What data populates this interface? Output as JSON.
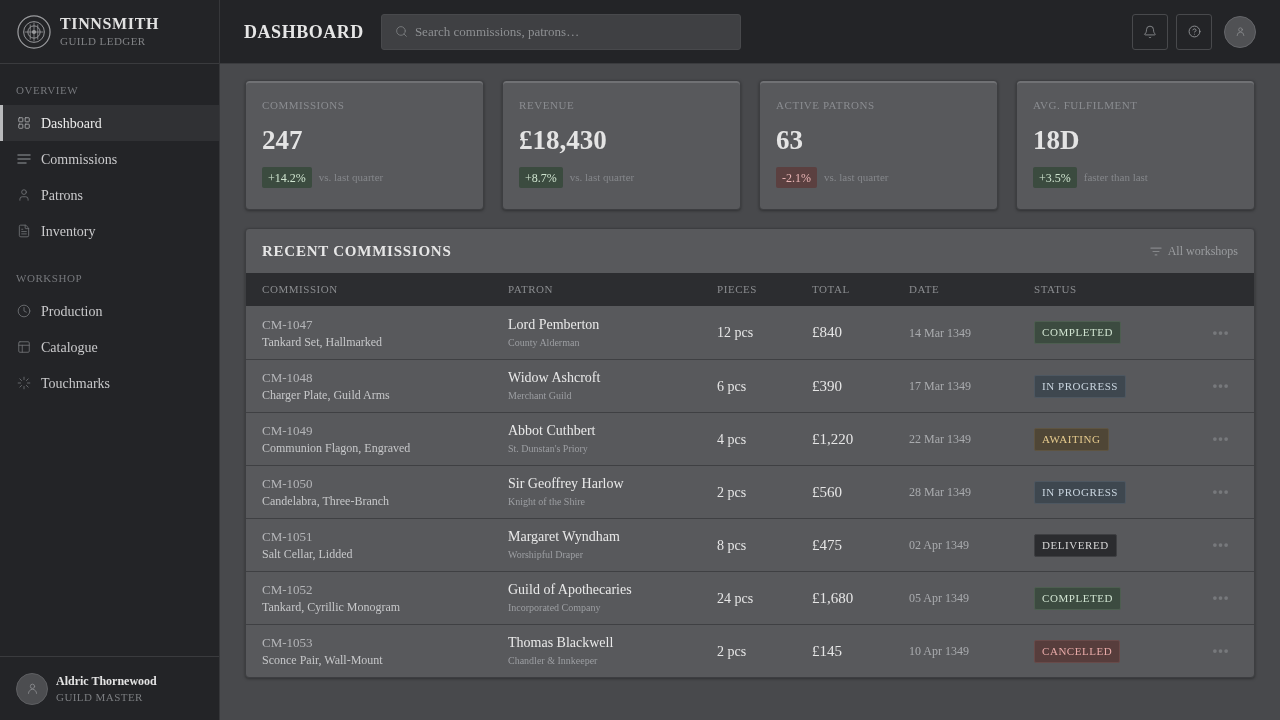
{
  "sidebar": {
    "brand": {
      "title": "TINNSMITH",
      "subtitle": "GUILD LEDGER"
    },
    "sections": [
      {
        "heading": "OVERVIEW",
        "items": [
          {
            "label": "Dashboard",
            "selected": true
          },
          {
            "label": "Commissions",
            "selected": false
          },
          {
            "label": "Patrons",
            "selected": false
          },
          {
            "label": "Inventory",
            "selected": false
          }
        ]
      },
      {
        "heading": "WORKSHOP",
        "items": [
          {
            "label": "Production",
            "selected": false
          },
          {
            "label": "Catalogue",
            "selected": false
          },
          {
            "label": "Touchmarks",
            "selected": false
          }
        ]
      }
    ],
    "user": {
      "name": "Aldric Thornewood",
      "role": "GUILD MASTER"
    }
  },
  "header": {
    "title": "DASHBOARD",
    "search": {
      "placeholder": "Search commissions, patrons…"
    }
  },
  "stats": [
    {
      "label": "COMMISSIONS",
      "value": "247",
      "delta": "+14.2%",
      "kind": "up",
      "note": "vs. last quarter"
    },
    {
      "label": "REVENUE",
      "value": "£18,430",
      "delta": "+8.7%",
      "kind": "up",
      "note": "vs. last quarter"
    },
    {
      "label": "ACTIVE PATRONS",
      "value": "63",
      "delta": "-2.1%",
      "kind": "down",
      "note": "vs. last quarter"
    },
    {
      "label": "AVG. FULFILMENT",
      "value": "18D",
      "delta": "+3.5%",
      "kind": "up",
      "note": "faster than last"
    }
  ],
  "table": {
    "title": "RECENT COMMISSIONS",
    "filter": "All workshops",
    "columns": [
      "COMMISSION",
      "PATRON",
      "PIECES",
      "TOTAL",
      "DATE",
      "STATUS"
    ],
    "rows": [
      {
        "id": "CM-1047",
        "item": "Tankard Set, Hallmarked",
        "patron": "Lord Pemberton",
        "patron_note": "County Alderman",
        "pieces": "12 pcs",
        "total": "£840",
        "date": "14 Mar 1349",
        "status": "COMPLETED",
        "kind": "completed"
      },
      {
        "id": "CM-1048",
        "item": "Charger Plate, Guild Arms",
        "patron": "Widow Ashcroft",
        "patron_note": "Merchant Guild",
        "pieces": "6 pcs",
        "total": "£390",
        "date": "17 Mar 1349",
        "status": "IN PROGRESS",
        "kind": "progress"
      },
      {
        "id": "CM-1049",
        "item": "Communion Flagon, Engraved",
        "patron": "Abbot Cuthbert",
        "patron_note": "St. Dunstan's Priory",
        "pieces": "4 pcs",
        "total": "£1,220",
        "date": "22 Mar 1349",
        "status": "AWAITING",
        "kind": "awaiting"
      },
      {
        "id": "CM-1050",
        "item": "Candelabra, Three-Branch",
        "patron": "Sir Geoffrey Harlow",
        "patron_note": "Knight of the Shire",
        "pieces": "2 pcs",
        "total": "£560",
        "date": "28 Mar 1349",
        "status": "IN PROGRESS",
        "kind": "progress"
      },
      {
        "id": "CM-1051",
        "item": "Salt Cellar, Lidded",
        "patron": "Margaret Wyndham",
        "patron_note": "Worshipful Draper",
        "pieces": "8 pcs",
        "total": "£475",
        "date": "02 Apr 1349",
        "status": "DELIVERED",
        "kind": "delivered"
      },
      {
        "id": "CM-1052",
        "item": "Tankard, Cyrillic Monogram",
        "patron": "Guild of Apothecaries",
        "patron_note": "Incorporated Company",
        "pieces": "24 pcs",
        "total": "£1,680",
        "date": "05 Apr 1349",
        "status": "COMPLETED",
        "kind": "completed"
      },
      {
        "id": "CM-1053",
        "item": "Sconce Pair, Wall-Mount",
        "patron": "Thomas Blackwell",
        "patron_note": "Chandler & Innkeeper",
        "pieces": "2 pcs",
        "total": "£145",
        "date": "10 Apr 1349",
        "status": "CANCELLED",
        "kind": "cancelled"
      }
    ]
  }
}
